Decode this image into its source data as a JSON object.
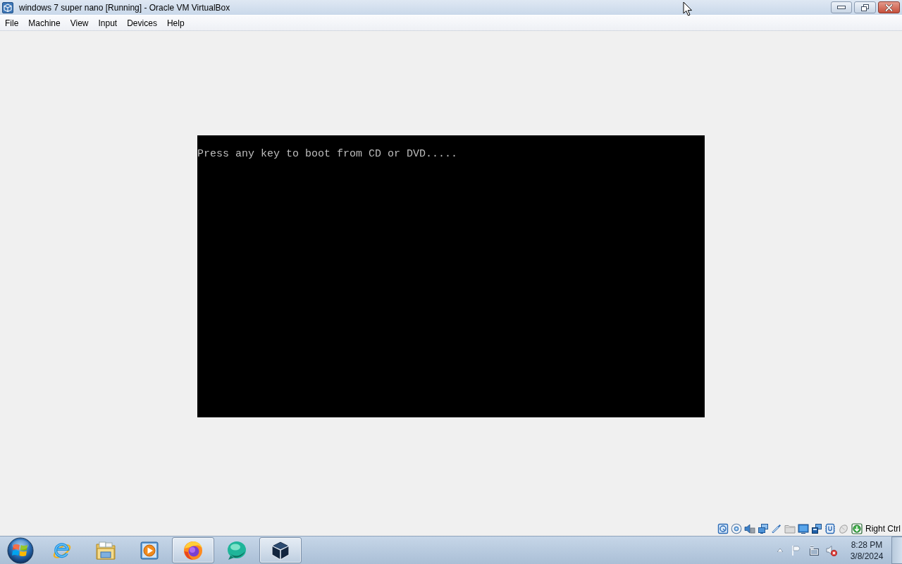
{
  "window": {
    "title": "windows 7 super nano [Running] - Oracle VM VirtualBox"
  },
  "menu_bar": [
    {
      "label": "File"
    },
    {
      "label": "Machine"
    },
    {
      "label": "View"
    },
    {
      "label": "Input"
    },
    {
      "label": "Devices"
    },
    {
      "label": "Help"
    }
  ],
  "vm_screen": {
    "text": "Press any key to boot from CD or DVD....."
  },
  "status_bar": {
    "host_key": "Right Ctrl"
  },
  "taskbar": {
    "items": [
      {
        "kind": "ie",
        "running": false
      },
      {
        "kind": "files",
        "running": false
      },
      {
        "kind": "player",
        "running": false
      },
      {
        "kind": "firefox",
        "running": true
      },
      {
        "kind": "bubble",
        "running": false
      },
      {
        "kind": "vbox",
        "running": true
      }
    ],
    "clock": {
      "time": "8:28 PM",
      "date": "3/8/2024"
    }
  }
}
